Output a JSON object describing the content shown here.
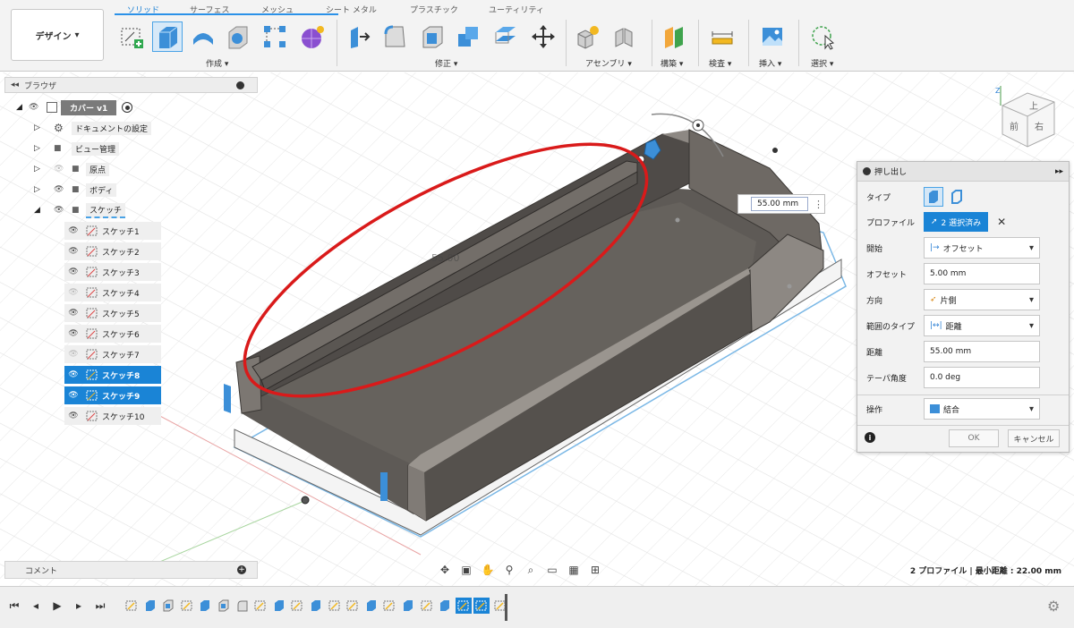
{
  "toolbar": {
    "design_label": "デザイン",
    "tabs": [
      "ソリッド",
      "サーフェス",
      "メッシュ",
      "シート メタル",
      "プラスチック",
      "ユーティリティ"
    ],
    "groups": {
      "create": "作成",
      "modify": "修正",
      "assemble": "アセンブリ",
      "construct": "構築",
      "inspect": "検査",
      "insert": "挿入",
      "select": "選択"
    }
  },
  "browser": {
    "title": "ブラウザ",
    "root": "カバー v1",
    "items": [
      "ドキュメントの設定",
      "ビュー管理",
      "原点",
      "ボディ",
      "スケッチ"
    ],
    "sketches": [
      "スケッチ1",
      "スケッチ2",
      "スケッチ3",
      "スケッチ4",
      "スケッチ5",
      "スケッチ6",
      "スケッチ7",
      "スケッチ8",
      "スケッチ9",
      "スケッチ10"
    ],
    "selected_sketches": [
      "スケッチ8",
      "スケッチ9"
    ]
  },
  "viewport": {
    "dimension_value": "55.00 mm",
    "ghost_dimension": "55.00",
    "viewcube": {
      "top": "上",
      "front": "前",
      "right": "右"
    },
    "accent": "#2b91e8",
    "annotation_color": "#d91a1a"
  },
  "extrude": {
    "title": "押し出し",
    "type_label": "タイプ",
    "profile_label": "プロファイル",
    "profile_value": "2 選択済み",
    "start_label": "開始",
    "start_value": "オフセット",
    "offset_label": "オフセット",
    "offset_value": "5.00 mm",
    "direction_label": "方向",
    "direction_value": "片側",
    "extent_label": "範囲のタイプ",
    "extent_value": "距離",
    "distance_label": "距離",
    "distance_value": "55.00 mm",
    "taper_label": "テーパ角度",
    "taper_value": "0.0 deg",
    "operation_label": "操作",
    "operation_value": "結合",
    "ok_label": "OK",
    "cancel_label": "キャンセル"
  },
  "comments": {
    "label": "コメント"
  },
  "status": {
    "text": "2 プロファイル | 最小距離 : 22.00 mm"
  },
  "colors": {
    "selection": "#1a84d6",
    "body": "#5e5a56",
    "sketch_line": "#7bb8e6"
  }
}
